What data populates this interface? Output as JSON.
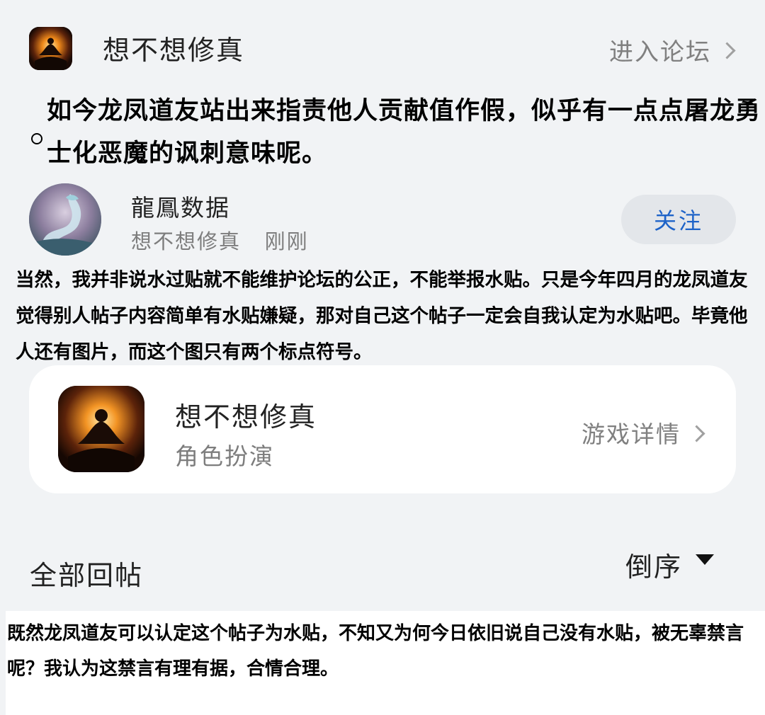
{
  "header": {
    "forum_name": "想不想修真",
    "enter_forum_label": "进入论坛"
  },
  "overlay_comment": {
    "line1": "如今龙凤道友站出来指责他人贡献值作假，似乎有一点点屠龙勇",
    "line2": "士化恶魔的讽刺意味呢。"
  },
  "post": {
    "author_name": "龍鳳数据",
    "author_forum": "想不想修真",
    "time": "刚刚",
    "follow_label": "关注",
    "body": "当然，我并非说水过贴就不能维护论坛的公正，不能举报水贴。只是今年四月的龙凤道友觉得别人帖子内容简单有水贴嫌疑，那对自己这个帖子一定会自我认定为水贴吧。毕竟他人还有图片，而这个图只有两个标点符号。"
  },
  "game_card": {
    "name": "想不想修真",
    "category": "角色扮演",
    "detail_label": "游戏详情"
  },
  "replies": {
    "title": "全部回帖",
    "sort_label": "倒序"
  },
  "bottom_comment": {
    "text": "既然龙凤道友可以认定这个帖子为水贴，不知又为何今日依旧说自己没有水贴，被无辜禁言呢？我认为这禁言有理有据，合情合理。"
  },
  "colors": {
    "page_bg": "#f1f3f5",
    "follow_text": "#1e63c8",
    "follow_bg": "#e3e6ea"
  },
  "icons": [
    "meditating-cultivator-icon",
    "chevron-right-icon",
    "dragon-avatar",
    "caret-down-icon"
  ]
}
